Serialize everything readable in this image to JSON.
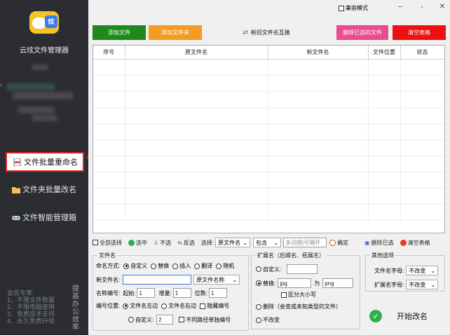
{
  "sidebar": {
    "app_title": "云炫文件管理器",
    "items": [
      {
        "label": "文件批量重命名",
        "active": true
      },
      {
        "label": "文件夹批量改名",
        "active": false
      },
      {
        "label": "文件智能管理箱",
        "active": false
      }
    ],
    "member_lines": [
      "会员专享:",
      "1、不限文件数量",
      "2、不限电脑使用",
      "3、免费技术支持",
      "4、永久免费升级"
    ],
    "vertical_text": "提高办公效率"
  },
  "titlebar": {
    "compat_label": "兼容模式"
  },
  "top_buttons": {
    "add_file": "添加文件",
    "add_folder": "添加文件夹",
    "swap": "新旧文件名互换",
    "delete_selected": "删除已选的文件",
    "clear_table": "清空表格"
  },
  "table": {
    "headers": [
      "序号",
      "原文件名",
      "新文件名",
      "文件位置",
      "状态"
    ]
  },
  "toolbar": {
    "select_all": "全部选择",
    "select": "选中",
    "unselect": "不选",
    "invert": "反选",
    "choose_label": "选择:",
    "choose_value": "原文件名",
    "match_value": "包含",
    "keyword_placeholder": "多词用|号隔开",
    "confirm": "确定",
    "delete_selected": "删除已选",
    "clear_table": "清空表格"
  },
  "filename_group": {
    "title": "文件名",
    "mode_label": "命名方式:",
    "modes": [
      "自定义",
      "替换",
      "插入",
      "翻译",
      "随机"
    ],
    "newname_label": "新文件名:",
    "newname_value": "",
    "newname_option": "原文件名称",
    "numbering_label": "名称编号:",
    "start_label": "起始:",
    "start_value": "1",
    "step_label": "增量:",
    "step_value": "1",
    "digits_label": "位数:",
    "digits_value": "1",
    "position_label": "编号位置:",
    "pos_left": "文件名左边",
    "pos_right": "文件名右边",
    "hide_number": "隐藏编号",
    "pos_custom": "自定义:",
    "pos_custom_value": "2",
    "no_separate": "不同路径单独编号"
  },
  "ext_group": {
    "title": "扩展名（后缀名、拓展名）",
    "custom": "自定义:",
    "custom_value": "",
    "replace": "替换:",
    "from_value": "jpg",
    "as_label": "为",
    "to_value": "png",
    "case_label": "区分大小写",
    "delete_label": "删除（会变成未知类型的文件）",
    "unchanged_label": "不改变"
  },
  "other_group": {
    "title": "其他选项",
    "charset_label": "文件名字母:",
    "charset_value": "不改变",
    "ext_charset_label": "扩展名字母:",
    "ext_charset_value": "不改变"
  },
  "start_button": "开始改名",
  "colors": {
    "sidebar_bg": "#2b2d33",
    "add_file": "#1e8a1e",
    "add_folder": "#f39c1f",
    "delete_selected": "#ea4c8c",
    "clear_table": "#ee1111",
    "annotation": "#e0251f"
  }
}
